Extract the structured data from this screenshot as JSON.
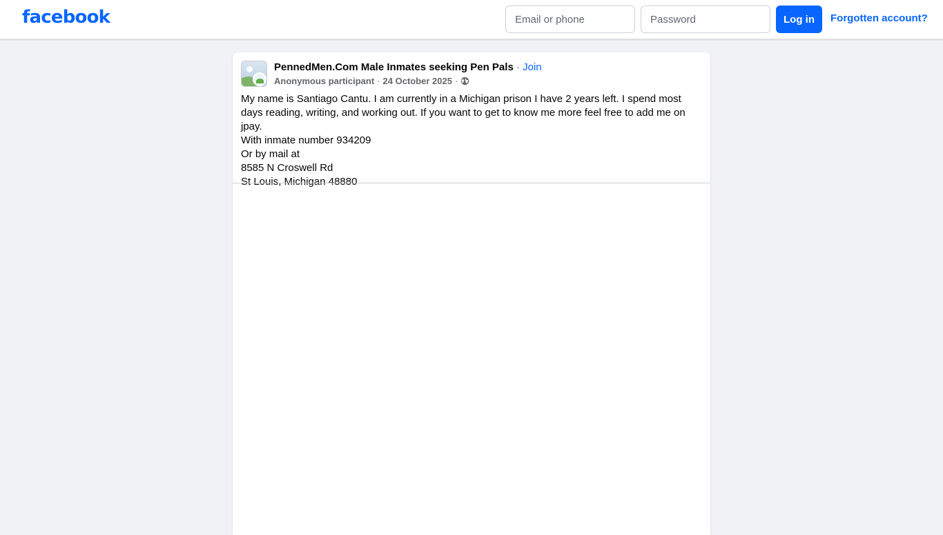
{
  "header": {
    "logo": "facebook",
    "email_placeholder": "Email or phone",
    "password_placeholder": "Password",
    "login_label": "Log in",
    "forgot_label": "Forgotten account?"
  },
  "post": {
    "group_name": "PennedMen.Com Male Inmates seeking Pen Pals",
    "separator": " · ",
    "join_label": "Join",
    "author": "Anonymous participant",
    "date": "24 October 2025",
    "privacy_icon": "globe-icon",
    "lines": [
      "My name is Santiago Cantu. I am currently in a Michigan prison I have 2 years left. I spend most days reading, writing, and working out. If you want to get to know me more feel free to add me on jpay.",
      "With inmate number 934209",
      "Or by mail at",
      "8585 N Croswell Rd",
      "St Louis, Michigan 48880"
    ]
  },
  "colors": {
    "brand": "#0866ff",
    "background": "#f0f2f5",
    "secondary_text": "#65676b"
  }
}
